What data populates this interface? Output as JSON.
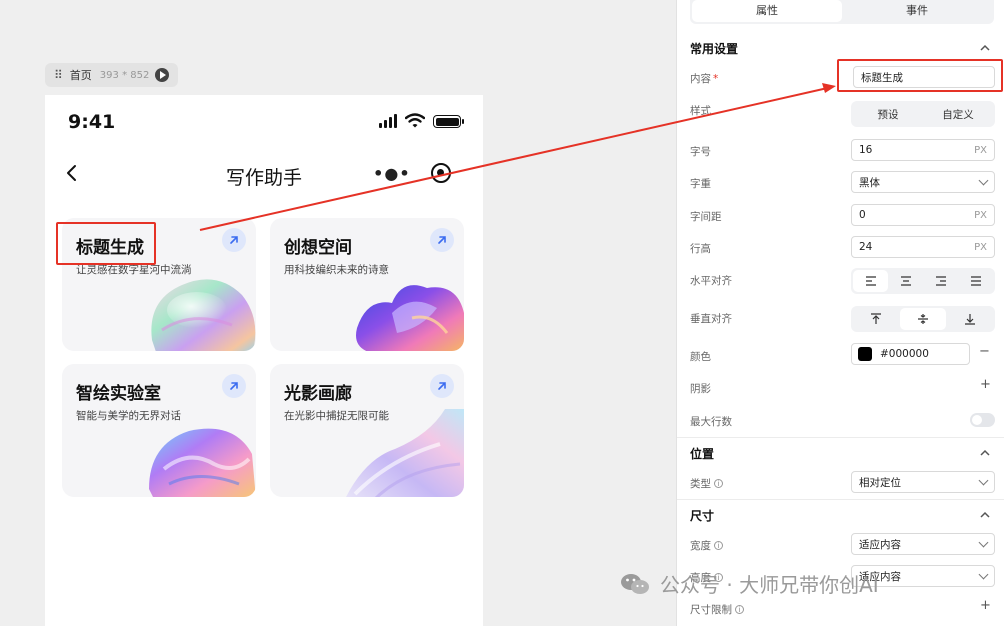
{
  "canvas": {
    "page_chip": {
      "name": "首页",
      "dims": "393 * 852"
    }
  },
  "phone": {
    "status_time": "9:41",
    "nav_title": "写作助手",
    "cards": [
      {
        "title": "标题生成",
        "subtitle": "让灵感在数字星河中流淌"
      },
      {
        "title": "创想空间",
        "subtitle": "用科技编织未来的诗意"
      },
      {
        "title": "智绘实验室",
        "subtitle": "智能与美学的无界对话"
      },
      {
        "title": "光影画廊",
        "subtitle": "在光影中捕捉无限可能"
      }
    ]
  },
  "panel": {
    "tabs": [
      {
        "label": "属性",
        "active": true
      },
      {
        "label": "事件",
        "active": false
      }
    ],
    "common": {
      "title": "常用设置",
      "content_label": "内容",
      "content_required": "*",
      "content_value": "标题生成",
      "style_label": "样式",
      "style_options": [
        "预设",
        "自定义"
      ],
      "font_size_label": "字号",
      "font_size_value": "16",
      "font_weight_label": "字重",
      "font_weight_value": "黑体",
      "letter_spacing_label": "字间距",
      "letter_spacing_value": "0",
      "line_height_label": "行高",
      "line_height_value": "24",
      "unit": "PX",
      "h_align_label": "水平对齐",
      "v_align_label": "垂直对齐",
      "color_label": "颜色",
      "color_value": "#000000",
      "shadow_label": "阴影",
      "max_lines_label": "最大行数"
    },
    "position": {
      "title": "位置",
      "type_label": "类型",
      "type_value": "相对定位"
    },
    "size": {
      "title": "尺寸",
      "width_label": "宽度",
      "width_value": "适应内容",
      "height_label": "高度",
      "height_value": "适应内容",
      "limit_label": "尺寸限制"
    }
  },
  "watermark": {
    "text": "公众号 · 大师兄带你创AI"
  },
  "colors": {
    "highlight": "#e53226",
    "accent": "#3b6cf0"
  }
}
